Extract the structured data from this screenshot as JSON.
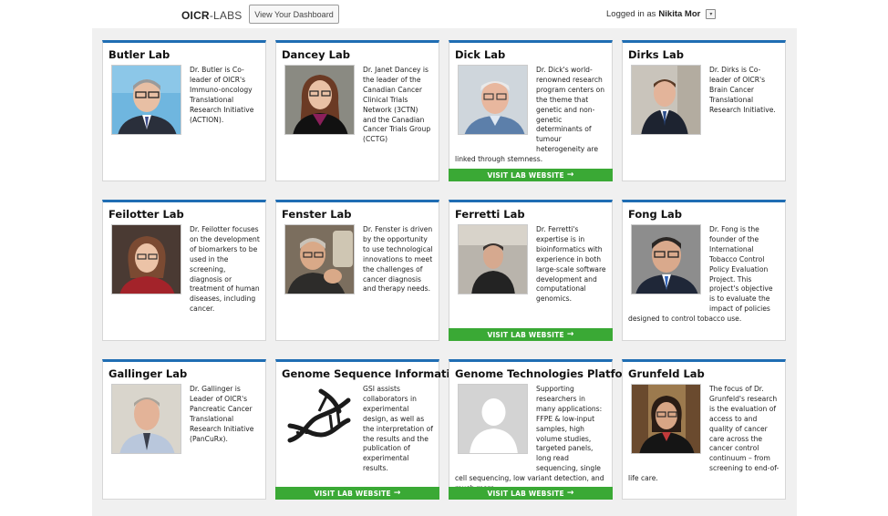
{
  "header": {
    "brand_bold": "OICR",
    "brand_rest": "-LABS",
    "dashboard_button": "View Your Dashboard",
    "logged_in_label": "Logged in as",
    "user_name": "Nikita Mor",
    "caret": "▾"
  },
  "colors": {
    "accent_bar": "#1f6db3",
    "button_green": "#3aa935",
    "content_bg": "#f0f0f0"
  },
  "cards": [
    {
      "title": "Butler Lab",
      "desc": "Dr. Butler is Co-leader of OICR's Immuno-oncology Translational Research Initiative (ACTION).",
      "button": ""
    },
    {
      "title": "Dancey Lab",
      "desc": "Dr. Janet Dancey is the leader of the Canadian Cancer Clinical Trials Network (3CTN) and the Canadian Cancer Trials Group (CCTG)",
      "button": ""
    },
    {
      "title": "Dick Lab",
      "desc": "Dr. Dick's world-renowned research program centers on the theme that genetic and non-genetic determinants of tumour heterogeneity are linked through stemness.",
      "button": "VISIT LAB WEBSITE"
    },
    {
      "title": "Dirks Lab",
      "desc": "Dr. Dirks is Co-leader of OICR's Brain Cancer Translational Research Initiative.",
      "button": ""
    },
    {
      "title": "Feilotter Lab",
      "desc": "Dr. Feilotter focuses on the development of biomarkers to be used in the screening, diagnosis or treatment of human diseases, including cancer.",
      "button": ""
    },
    {
      "title": "Fenster Lab",
      "desc": "Dr. Fenster is driven by the opportunity to use technological innovations to meet the challenges of cancer diagnosis and therapy needs.",
      "button": ""
    },
    {
      "title": "Ferretti Lab",
      "desc": "Dr. Ferretti's expertise is in bioinformatics with experience in both large-scale software development and computational genomics.",
      "button": "VISIT LAB WEBSITE"
    },
    {
      "title": "Fong Lab",
      "desc": "Dr. Fong is the founder of the International Tobacco Control Policy Evaluation Project. This project's objective is to evaluate the impact of policies designed to control tobacco use.",
      "button": ""
    },
    {
      "title": "Gallinger Lab",
      "desc": "Dr. Gallinger is Leader of OICR's Pancreatic Cancer Translational Research Initiative (PanCuRx).",
      "button": ""
    },
    {
      "title": "Genome Sequence Informatics",
      "desc": "GSI assists collaborators in experimental design, as well as the interpretation of the results and the publication of experimental results.",
      "button": "VISIT LAB WEBSITE"
    },
    {
      "title": "Genome Technologies Platform",
      "desc": "Supporting researchers in many applications: FFPE & low-input samples, high volume studies, targeted panels, long read sequencing, single cell sequencing, low variant detection, and much more",
      "button": "VISIT LAB WEBSITE"
    },
    {
      "title": "Grunfeld Lab",
      "desc": "The focus of Dr. Grunfeld's research is the evaluation of access to and quality of cancer care across the cancer control continuum – from screening to end-of-life care.",
      "button": ""
    }
  ]
}
